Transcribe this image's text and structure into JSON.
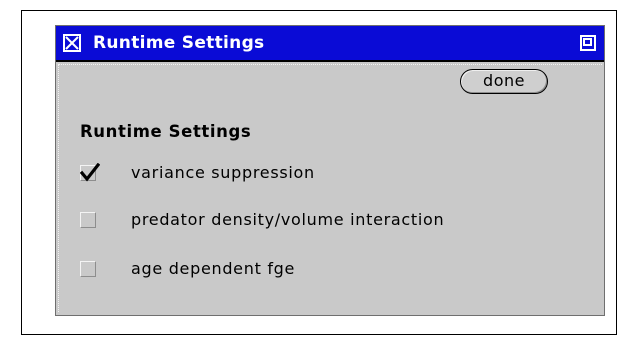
{
  "window": {
    "title": "Runtime Settings",
    "close_icon": "close-x-icon",
    "resize_icon": "resize-icon"
  },
  "toolbar": {
    "done_label": "done"
  },
  "section": {
    "heading": "Runtime Settings"
  },
  "options": [
    {
      "label": "variance suppression",
      "checked": true
    },
    {
      "label": "predator density/volume interaction",
      "checked": false
    },
    {
      "label": "age dependent fge",
      "checked": false
    }
  ],
  "colors": {
    "titlebar": "#0a0bd6",
    "window_bg": "#c9c9c9",
    "title_text": "#ffffff"
  }
}
